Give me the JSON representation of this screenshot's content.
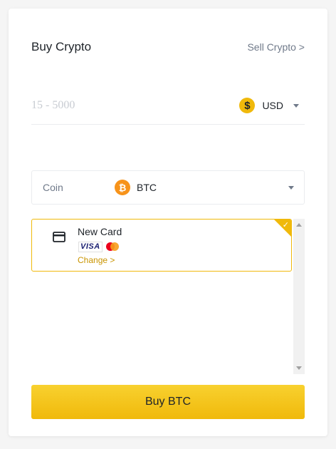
{
  "header": {
    "title": "Buy Crypto",
    "sell_link": "Sell Crypto >"
  },
  "amount": {
    "placeholder": "15 - 5000",
    "value": "",
    "currency": "USD",
    "currency_icon": "dollar-coin-icon"
  },
  "coin": {
    "label": "Coin",
    "value": "BTC",
    "icon": "bitcoin-icon"
  },
  "payment": {
    "card_name": "New Card",
    "brands": [
      "VISA",
      "Mastercard"
    ],
    "change_link": "Change >",
    "selected": true
  },
  "buy_button": {
    "label": "Buy BTC"
  },
  "colors": {
    "accent": "#f0b90b",
    "accent_light": "#f8d12f",
    "link": "#c99400",
    "muted_text": "#707a8a",
    "text": "#1e2329",
    "bitcoin": "#f7931a"
  }
}
